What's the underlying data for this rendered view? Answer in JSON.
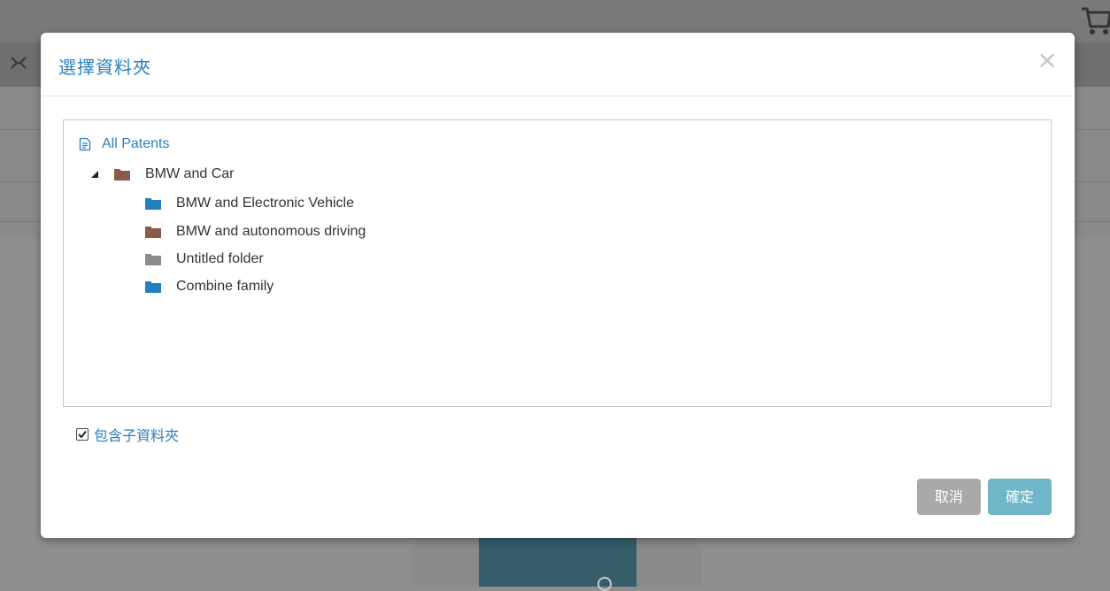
{
  "dialog": {
    "title": "選擇資料夾",
    "close_label": "×"
  },
  "tree": {
    "root": {
      "label": "All Patents",
      "icon": "document-icon"
    },
    "nodes": [
      {
        "label": "BMW and Car",
        "expanded": true,
        "color": "#8a5a4a",
        "level": 0
      },
      {
        "label": "BMW and Electronic Vehicle",
        "color": "#1f7fc0",
        "level": 1
      },
      {
        "label": "BMW and autonomous driving",
        "color": "#8a5a4a",
        "level": 1
      },
      {
        "label": "Untitled folder",
        "color": "#8c8c8c",
        "level": 1
      },
      {
        "label": "Combine family",
        "color": "#1f7fc0",
        "level": 1
      }
    ]
  },
  "include_subfolders": {
    "label": "包含子資料夾",
    "checked": true
  },
  "buttons": {
    "cancel": "取消",
    "ok": "確定"
  },
  "colors": {
    "accent": "#2a7fbf",
    "ok_button": "#6fb6c8",
    "cancel_button": "#a9a9a9",
    "overlay": "#8f8f8f"
  }
}
